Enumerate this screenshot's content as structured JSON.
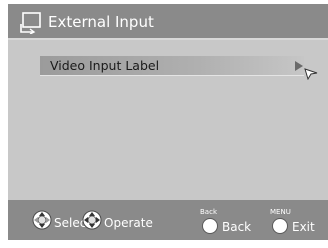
{
  "window": {
    "title": "External Input",
    "icon": "external-input-icon"
  },
  "menu": {
    "items": [
      {
        "label": "Video Input Label",
        "indicator": "arrow-right-icon",
        "selected": true
      }
    ]
  },
  "footer": {
    "select": {
      "label": "Select",
      "icon": "dpad-updown-icon"
    },
    "operate": {
      "label": "Operate",
      "icon": "dpad-4way-icon"
    },
    "back": {
      "key_label": "Back",
      "label": "Back",
      "icon": "round-button-icon"
    },
    "exit": {
      "key_label": "MENU",
      "label": "Exit",
      "icon": "round-button-icon"
    }
  },
  "colors": {
    "title_bar": "#8a8a8a",
    "content": "#c8c8c8",
    "footer": "#8a8a8a",
    "highlight": "#9b9b9b",
    "text_light": "#ffffff",
    "text_dark": "#1a1a1a"
  }
}
